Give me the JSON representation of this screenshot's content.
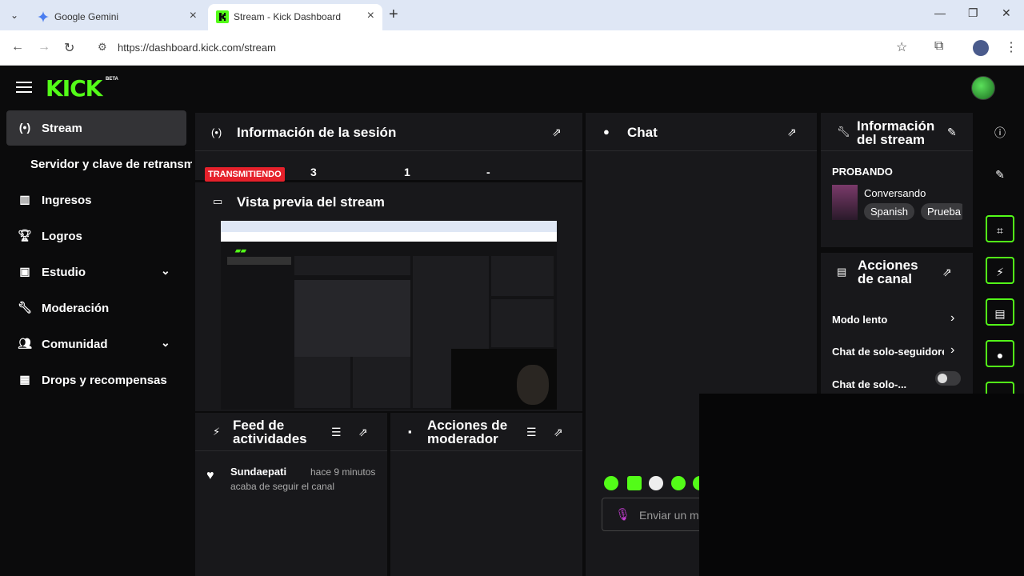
{
  "browser": {
    "tabs": [
      {
        "title": "Google Gemini"
      },
      {
        "title": "Stream - Kick Dashboard"
      }
    ],
    "url": "https://dashboard.kick.com/stream"
  },
  "header": {
    "logo": "KICK",
    "beta": "BETA"
  },
  "sidebar": {
    "items": [
      {
        "label": "Stream",
        "icon": "broadcast-icon"
      },
      {
        "label": "Servidor y clave de retransmisión"
      },
      {
        "label": "Ingresos",
        "icon": "chart-icon"
      },
      {
        "label": "Logros",
        "icon": "trophy-icon"
      },
      {
        "label": "Estudio",
        "icon": "studio-icon"
      },
      {
        "label": "Moderación",
        "icon": "wrench-icon"
      },
      {
        "label": "Comunidad",
        "icon": "community-icon"
      },
      {
        "label": "Drops y recompensas",
        "icon": "drops-icon"
      }
    ]
  },
  "session": {
    "title": "Información de la sesión",
    "live_badge": "TRANSMITIENDO",
    "stat1": "3",
    "stat2": "1",
    "stat3": "-"
  },
  "preview": {
    "title": "Vista previa del stream"
  },
  "chat": {
    "title": "Chat",
    "input_placeholder": "Enviar un m"
  },
  "stream_info": {
    "title_line1": "Información",
    "title_line2": "del stream",
    "stream_title": "PROBANDO",
    "category": "Conversando",
    "tags": [
      "Spanish",
      "Prueba"
    ]
  },
  "channel_actions": {
    "title_line1": "Acciones",
    "title_line2": "de canal",
    "rows": [
      "Modo lento",
      "Chat de solo-seguidores",
      "Chat de solo-..."
    ]
  },
  "feed": {
    "title_line1": "Feed de",
    "title_line2": "actividades",
    "items": [
      {
        "name": "Sundaepati",
        "time": "hace 9 minutos",
        "text": "acaba de seguir el canal"
      }
    ]
  },
  "mod_actions": {
    "title_line1": "Acciones de",
    "title_line2": "moderador"
  },
  "colors": {
    "accent": "#53fc18",
    "live": "#e6212b",
    "panel": "#18181b"
  }
}
